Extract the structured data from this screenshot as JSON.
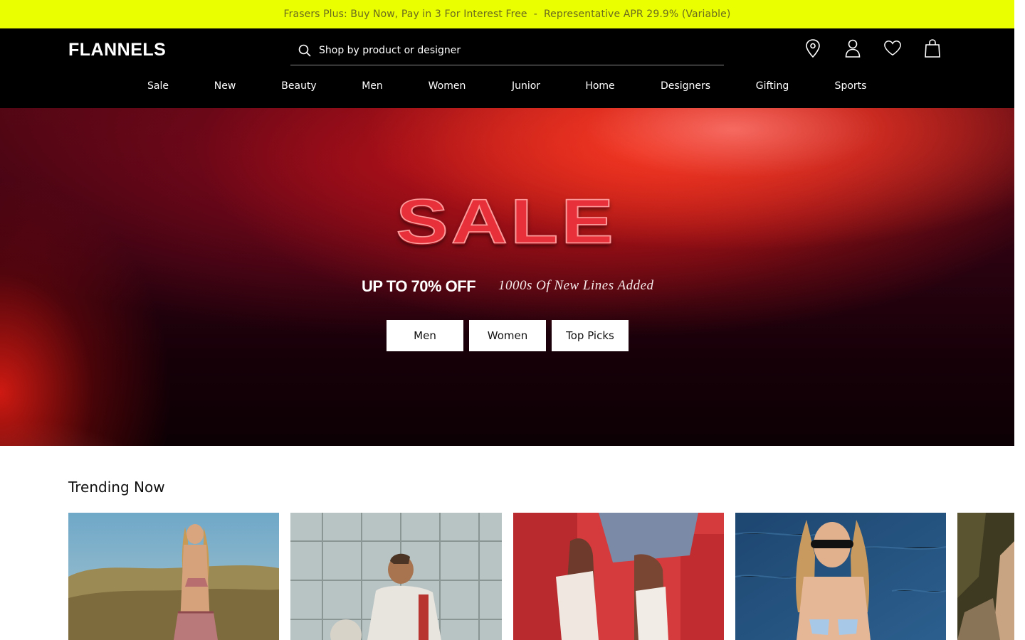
{
  "promo": {
    "text": "Frasers Plus: Buy Now, Pay in 3 For Interest Free  -  Representative APR 29.9% (Variable)",
    "background": "#eaff00"
  },
  "header": {
    "logo": "FLANNELS",
    "search": {
      "placeholder": "Shop by product or designer",
      "icon": "search-icon"
    },
    "icons": [
      {
        "name": "store-locator-icon"
      },
      {
        "name": "account-icon"
      },
      {
        "name": "wishlist-icon"
      },
      {
        "name": "bag-icon"
      }
    ],
    "nav": [
      "Sale",
      "New",
      "Beauty",
      "Men",
      "Women",
      "Junior",
      "Home",
      "Designers",
      "Gifting",
      "Sports"
    ]
  },
  "hero": {
    "title": "SALE",
    "subtitle": "UP TO 70% OFF",
    "note": "1000s Of New Lines Added",
    "buttons": [
      "Men",
      "Women",
      "Top Picks"
    ],
    "accent": "#e8303a"
  },
  "trending": {
    "title": "Trending Now",
    "tiles": [
      {
        "name": "trending-tile-swimwear-woman"
      },
      {
        "name": "trending-tile-man-jacket"
      },
      {
        "name": "trending-tile-socks"
      },
      {
        "name": "trending-tile-bikini-boat"
      },
      {
        "name": "trending-tile-partial"
      }
    ]
  }
}
